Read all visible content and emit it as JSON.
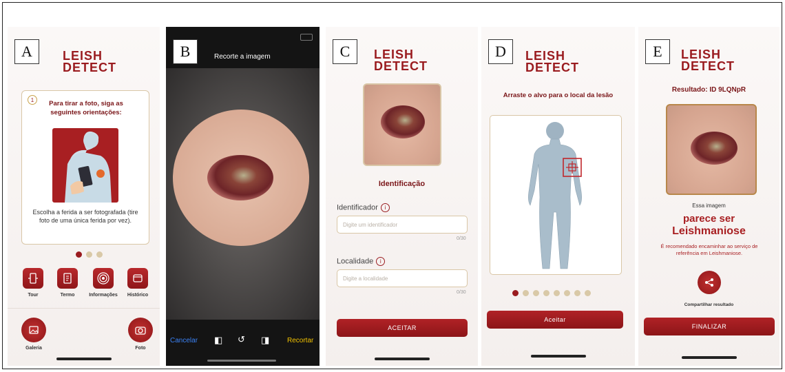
{
  "logo": {
    "line1": "LEISH",
    "line2": "DETECT"
  },
  "panel_a": {
    "tag": "A",
    "step_number": "1",
    "heading": "Para tirar a foto, siga as seguintes orientações:",
    "instruction": "Escolha a ferida a ser fotografada (tire foto de uma única ferida por vez).",
    "menu": [
      {
        "label": "Tour",
        "icon": "tour-icon"
      },
      {
        "label": "Termo",
        "icon": "document-icon"
      },
      {
        "label": "Informações",
        "icon": "info-signal-icon"
      },
      {
        "label": "Histórico",
        "icon": "history-icon"
      }
    ],
    "gallery_label": "Galeria",
    "photo_label": "Foto"
  },
  "panel_b": {
    "tag": "B",
    "title": "Recorte a imagem",
    "cancel": "Cancelar",
    "crop": "Recortar"
  },
  "panel_c": {
    "tag": "C",
    "section_title": "Identificação",
    "id_label": "Identificador",
    "id_placeholder": "Digite um identificador",
    "id_counter": "0/30",
    "loc_label": "Localidade",
    "loc_placeholder": "Digite a localidade",
    "loc_counter": "0/30",
    "accept": "ACEITAR"
  },
  "panel_d": {
    "tag": "D",
    "instruction": "Arraste o alvo para o local da lesão",
    "accept": "Aceitar",
    "pages": 8,
    "current_page": 1
  },
  "panel_e": {
    "tag": "E",
    "result_title": "Resultado: ID 9LQNpR",
    "this_image": "Essa imagem",
    "seems_to_be": "parece ser",
    "diagnosis": "Leishmaniose",
    "recommendation": "É recomendado encaminhar ao serviço de referência em Leishmaniose.",
    "share_label": "Compartilhar resultado",
    "finish": "FINALIZAR"
  },
  "colors": {
    "brand_red": "#9a1b1f",
    "gold_border": "#d9c6a6",
    "ios_blue": "#3b82f6",
    "ios_yellow": "#f2c200"
  }
}
